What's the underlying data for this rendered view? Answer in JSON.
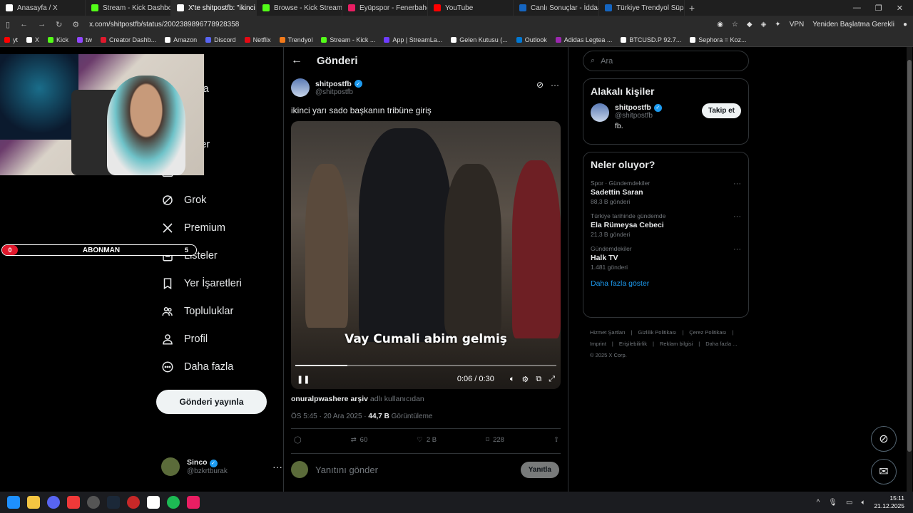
{
  "browser": {
    "tabs": [
      {
        "label": "Anasayfa / X",
        "color": "#ffffff",
        "active": false
      },
      {
        "label": "Stream - Kick Dashboard",
        "color": "#53fc18",
        "active": false
      },
      {
        "label": "X'te shitpostfb: \"ikinci yarı s...",
        "color": "#ffffff",
        "active": true
      },
      {
        "label": "Browse - Kick Streaming",
        "color": "#53fc18",
        "active": false
      },
      {
        "label": "Eyüpspor - Fenerbahçe Ma...",
        "color": "#e91e63",
        "active": false
      },
      {
        "label": "YouTube",
        "color": "#ff0000",
        "active": false
      },
      {
        "label": "Canlı Sonuçlar - İddaa Son...",
        "color": "#1565c0",
        "active": false
      },
      {
        "label": "Türkiye Trendyol Süper Lig",
        "color": "#1565c0",
        "active": false
      }
    ],
    "url": "x.com/shitpostfb/status/2002389896778928358",
    "restart_label": "Yeniden Başlatma Gerekli",
    "bookmarks": [
      {
        "label": "yt",
        "color": "#ff0000"
      },
      {
        "label": "X",
        "color": "#ffffff"
      },
      {
        "label": "Kick",
        "color": "#53fc18"
      },
      {
        "label": "tw",
        "color": "#9146ff"
      },
      {
        "label": "Creator Dashb...",
        "color": "#e0192d"
      },
      {
        "label": "Amazon",
        "color": "#ffffff"
      },
      {
        "label": "Discord",
        "color": "#5865f2"
      },
      {
        "label": "Netflix",
        "color": "#e50914"
      },
      {
        "label": "Trendyol",
        "color": "#f27a1a"
      },
      {
        "label": "Stream - Kick ...",
        "color": "#53fc18"
      },
      {
        "label": "App | StreamLa...",
        "color": "#6e3cff"
      },
      {
        "label": "Gelen Kutusu (...",
        "color": "#ffffff"
      },
      {
        "label": "Outlook",
        "color": "#0078d4"
      },
      {
        "label": "Adidas Legtea ...",
        "color": "#9c27b0"
      },
      {
        "label": "BTCUSD.P 92.7...",
        "color": "#ffffff"
      },
      {
        "label": "Sephora = Koz...",
        "color": "#ffffff"
      }
    ]
  },
  "overlay": {
    "sub_count": "0",
    "sub_label": "ABONMAN",
    "sub_goal": "5"
  },
  "nav": {
    "items": [
      {
        "label": "sayfa"
      },
      {
        "label": "et"
      },
      {
        "label": "rimler"
      },
      {
        "label": "bet"
      },
      {
        "label": "Grok"
      },
      {
        "label": "Premium"
      },
      {
        "label": "Listeler"
      },
      {
        "label": "Yer İşaretleri"
      },
      {
        "label": "Topluluklar"
      },
      {
        "label": "Profil"
      },
      {
        "label": "Daha fazla"
      }
    ],
    "post_button": "Gönderi yayınla",
    "account": {
      "name": "Sinco",
      "handle": "@bzkrtburak"
    }
  },
  "post": {
    "header_title": "Gönderi",
    "author_name": "shitpostfb",
    "author_handle": "@shitpostfb",
    "text": "ikinci yarı sado başkanın tribüne giriş",
    "video": {
      "caption": "Vay Cumali abim gelmiş",
      "time": "0:06 / 0:30",
      "progress": 0.2
    },
    "attribution_user": "onuralpwashere arşiv",
    "attribution_suffix": "adlı kullanıcıdan",
    "timestamp": "ÖS 5:45 · 20 Ara 2025 · ",
    "views": "44,7 B",
    "views_label": "Görüntüleme",
    "stats": {
      "retweets": "60",
      "likes": "2 B",
      "bookmarks": "228"
    },
    "reply_placeholder": "Yanıtını gönder",
    "reply_button": "Yanıtla"
  },
  "sidebar": {
    "search_placeholder": "Ara",
    "related_title": "Alakalı kişiler",
    "related": {
      "name": "shitpostfb",
      "handle": "@shitpostfb",
      "bio": "fb.",
      "follow": "Takip et"
    },
    "trends_title": "Neler oluyor?",
    "trends": [
      {
        "context": "Spor · Gündemdekiler",
        "title": "Sadettin Saran",
        "posts": "88,3 B gönderi"
      },
      {
        "context": "Türkiye tarihinde gündemde",
        "title": "Ela Rümeysa Cebeci",
        "posts": "21,3 B gönderi"
      },
      {
        "context": "Gündemdekiler",
        "title": "Halk TV",
        "posts": "1.481 gönderi"
      }
    ],
    "show_more": "Daha fazla göster",
    "footer": [
      "Hizmet Şartları",
      "|",
      "Gizlilik Politikası",
      "|",
      "Çerez Politikası",
      "|",
      "Imprint",
      "|",
      "Erişilebilirlik",
      "|",
      "Reklam bilgisi",
      "|",
      "Daha fazla ...",
      "© 2025 X Corp."
    ]
  },
  "taskbar": {
    "time": "15:11",
    "date": "21.12.2025"
  }
}
